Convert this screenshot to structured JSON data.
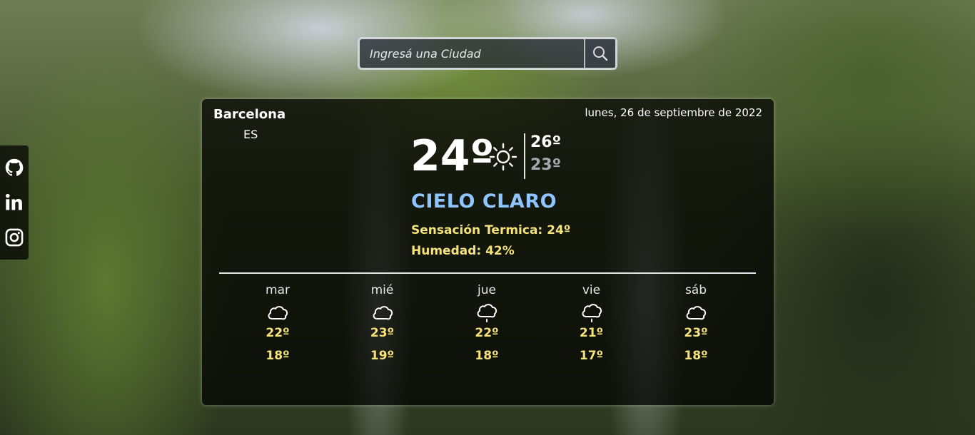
{
  "search": {
    "placeholder": "Ingresá una Ciudad",
    "icon": "search-icon"
  },
  "social": [
    {
      "name": "github",
      "icon": "github-icon"
    },
    {
      "name": "linkedin",
      "icon": "linkedin-icon"
    },
    {
      "name": "instagram",
      "icon": "instagram-icon"
    }
  ],
  "current": {
    "city": "Barcelona",
    "country": "ES",
    "date": "lunes, 26 de septiembre de 2022",
    "temp": "24º",
    "icon": "sun-icon",
    "max": "26º",
    "min": "23º",
    "description": "CIELO CLARO",
    "feels_like": "Sensación Termica: 24º",
    "humidity": "Humedad: 42%"
  },
  "forecast": [
    {
      "day": "mar",
      "icon": "cloud-icon",
      "max": "22º",
      "min": "18º"
    },
    {
      "day": "mié",
      "icon": "cloud-icon",
      "max": "23º",
      "min": "19º"
    },
    {
      "day": "jue",
      "icon": "cloud-drizzle-icon",
      "max": "22º",
      "min": "18º"
    },
    {
      "day": "vie",
      "icon": "cloud-drizzle-icon",
      "max": "21º",
      "min": "17º"
    },
    {
      "day": "sáb",
      "icon": "cloud-icon",
      "max": "23º",
      "min": "18º"
    }
  ],
  "colors": {
    "description": "#8ec5ff",
    "accent": "#f5e27a",
    "min_temp": "#a6a8ae"
  }
}
